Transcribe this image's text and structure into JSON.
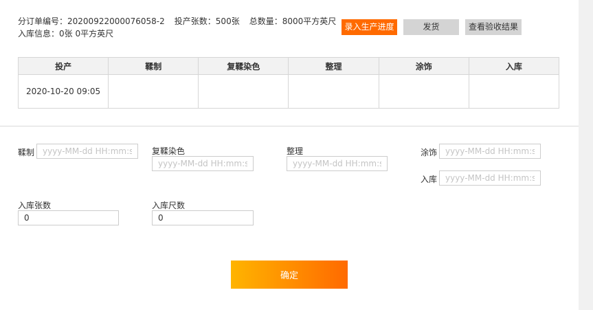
{
  "order": {
    "number_label": "分订单编号：",
    "number_value": "20200922000076058-2",
    "sheets_label": "投产张数：",
    "sheets_value": "500张",
    "total_label": "总数量：",
    "total_value": "8000平方英尺",
    "storage_label": "入库信息：",
    "storage_value": "0张 0平方英尺"
  },
  "toolbar": {
    "record_progress": "录入生产进度",
    "ship": "发货",
    "view_inspection": "查看验收结果"
  },
  "table": {
    "headers": [
      "投产",
      "鞣制",
      "复鞣染色",
      "整理",
      "涂饰",
      "入库"
    ],
    "row": [
      "2020-10-20 09:05",
      "",
      "",
      "",
      "",
      ""
    ]
  },
  "form": {
    "tanning_label": "鞣制",
    "retanning_label": "复鞣染色",
    "finishing_label": "整理",
    "coating_label": "涂饰",
    "storage_label": "入库",
    "date_placeholder": "yyyy-MM-dd HH:mm:ss",
    "storage_sheets_label": "入库张数",
    "storage_sheets_value": "0",
    "storage_feet_label": "入库尺数",
    "storage_feet_value": "0"
  },
  "confirm_label": "确定"
}
